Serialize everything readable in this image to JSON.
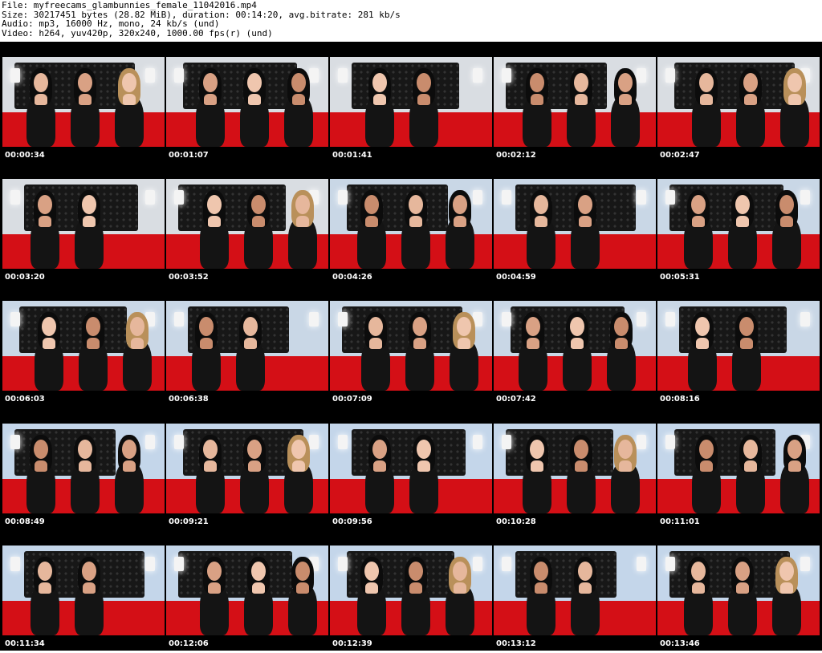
{
  "header": {
    "file": "File: myfreecams_glambunnies_female_11042016.mp4",
    "size": "Size: 30217451 bytes (28.82 MiB), duration: 00:14:20, avg.bitrate: 281 kb/s",
    "audio": "Audio: mp3, 16000 Hz, mono, 24 kb/s (und)",
    "video": "Video: h264, yuv420p, 320x240, 1000.00 fps(r) (und)"
  },
  "thumbnails": [
    {
      "time": "00:00:34",
      "scene": "a"
    },
    {
      "time": "00:01:07",
      "scene": "a"
    },
    {
      "time": "00:01:41",
      "scene": "a"
    },
    {
      "time": "00:02:12",
      "scene": "a"
    },
    {
      "time": "00:02:47",
      "scene": "a"
    },
    {
      "time": "00:03:20",
      "scene": "a"
    },
    {
      "time": "00:03:52",
      "scene": "a"
    },
    {
      "time": "00:04:26",
      "scene": "b"
    },
    {
      "time": "00:04:59",
      "scene": "b"
    },
    {
      "time": "00:05:31",
      "scene": "b"
    },
    {
      "time": "00:06:03",
      "scene": "b"
    },
    {
      "time": "00:06:38",
      "scene": "b"
    },
    {
      "time": "00:07:09",
      "scene": "b"
    },
    {
      "time": "00:07:42",
      "scene": "b"
    },
    {
      "time": "00:08:16",
      "scene": "b"
    },
    {
      "time": "00:08:49",
      "scene": "c"
    },
    {
      "time": "00:09:21",
      "scene": "c"
    },
    {
      "time": "00:09:56",
      "scene": "c"
    },
    {
      "time": "00:10:28",
      "scene": "c"
    },
    {
      "time": "00:11:01",
      "scene": "c"
    },
    {
      "time": "00:11:34",
      "scene": "c"
    },
    {
      "time": "00:12:06",
      "scene": "c"
    },
    {
      "time": "00:12:39",
      "scene": "c"
    },
    {
      "time": "00:13:12",
      "scene": "c"
    },
    {
      "time": "00:13:46",
      "scene": "c"
    }
  ],
  "colors": {
    "background": "#000000",
    "header_bg": "#ffffff",
    "bed_red": "#d40f16",
    "timestamp": "#ffffff"
  }
}
